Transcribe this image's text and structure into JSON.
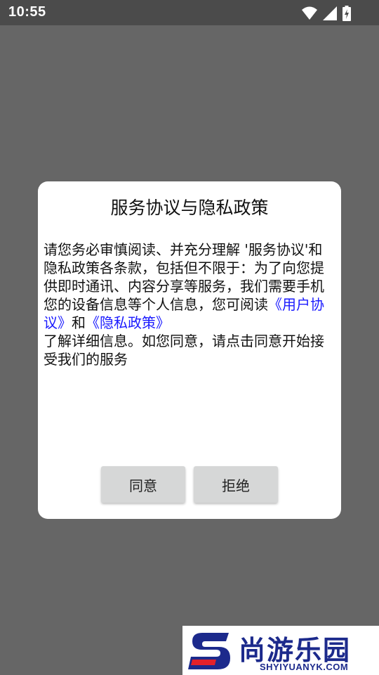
{
  "status_bar": {
    "time": "10:55",
    "icons": [
      "wifi-icon",
      "cell-signal-icon",
      "battery-charging-icon"
    ]
  },
  "dialog": {
    "title": "服务协议与隐私政策",
    "body_prefix": "请您务必审慎阅读、并充分理解 '服务协议'和隐私政策各条款，包括但不限于：为了向您提供即时通讯、内容分享等服务，我们需要手机您的设备信息等个人信息，您可阅读",
    "link_user_agreement": "《用户协议》",
    "conjunction": "和",
    "link_privacy_policy": "《隐私政策》",
    "body_suffix": "了解详细信息。如您同意，请点击同意开始接受我们的服务",
    "agree_label": "同意",
    "reject_label": "拒绝"
  },
  "watermark": {
    "brand_cn": "尚游乐园",
    "brand_en": "SHYIYUANYK.COM"
  },
  "colors": {
    "overlay": "#666666",
    "status_bar": "#4b4b4b",
    "link": "#1a1aff",
    "button": "#d6d7d7",
    "watermark_brand": "#1c2a8c"
  }
}
